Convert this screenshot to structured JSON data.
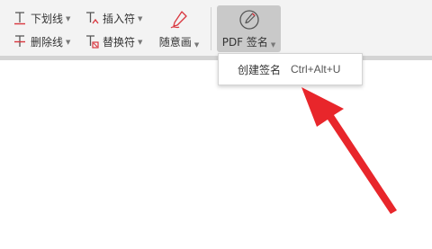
{
  "toolbar": {
    "underline": {
      "label": "下划线",
      "icon": "underline-text-icon"
    },
    "strikethrough": {
      "label": "删除线",
      "icon": "strikethrough-text-icon"
    },
    "insert_text": {
      "label": "插入符",
      "icon": "insert-text-icon"
    },
    "replace_text": {
      "label": "替换符",
      "icon": "replace-text-icon"
    },
    "freehand": {
      "label": "随意画",
      "icon": "pen-icon"
    },
    "pdf_sign": {
      "label": "PDF 签名",
      "icon": "signature-pen-icon"
    }
  },
  "dropdown": {
    "items": [
      {
        "label": "创建签名",
        "shortcut": "Ctrl+Alt+U"
      }
    ]
  },
  "annotation": {
    "arrow_color": "#e8262b"
  }
}
